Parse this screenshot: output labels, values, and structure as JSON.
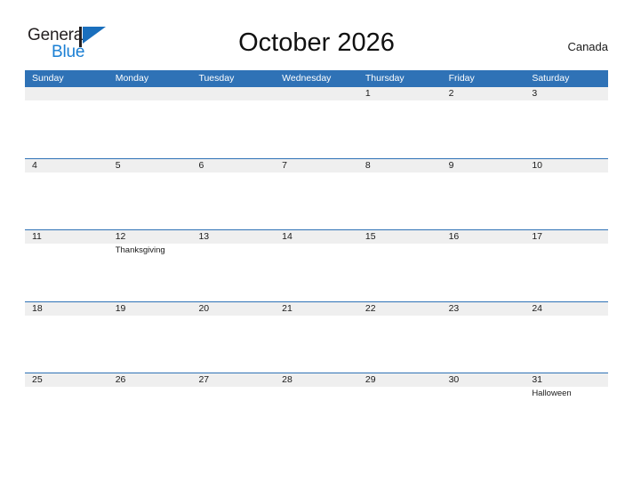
{
  "logo": {
    "word_top": "General",
    "word_bottom": "Blue",
    "flag_icon": "blue-flag-triangle-icon",
    "color_text": "#231f20",
    "color_blue": "#1a7fd4"
  },
  "header": {
    "title": "October 2026",
    "country": "Canada"
  },
  "theme": {
    "header_blue": "#2f72b6",
    "row_band_gray": "#efefef",
    "rule_blue": "#2f72b6",
    "page_background": "#ffffff"
  },
  "calendar": {
    "month": "October",
    "year": "2026",
    "weekdays": [
      "Sunday",
      "Monday",
      "Tuesday",
      "Wednesday",
      "Thursday",
      "Friday",
      "Saturday"
    ],
    "weeks": [
      [
        {
          "day": "",
          "event": ""
        },
        {
          "day": "",
          "event": ""
        },
        {
          "day": "",
          "event": ""
        },
        {
          "day": "",
          "event": ""
        },
        {
          "day": "1",
          "event": ""
        },
        {
          "day": "2",
          "event": ""
        },
        {
          "day": "3",
          "event": ""
        }
      ],
      [
        {
          "day": "4",
          "event": ""
        },
        {
          "day": "5",
          "event": ""
        },
        {
          "day": "6",
          "event": ""
        },
        {
          "day": "7",
          "event": ""
        },
        {
          "day": "8",
          "event": ""
        },
        {
          "day": "9",
          "event": ""
        },
        {
          "day": "10",
          "event": ""
        }
      ],
      [
        {
          "day": "11",
          "event": ""
        },
        {
          "day": "12",
          "event": "Thanksgiving"
        },
        {
          "day": "13",
          "event": ""
        },
        {
          "day": "14",
          "event": ""
        },
        {
          "day": "15",
          "event": ""
        },
        {
          "day": "16",
          "event": ""
        },
        {
          "day": "17",
          "event": ""
        }
      ],
      [
        {
          "day": "18",
          "event": ""
        },
        {
          "day": "19",
          "event": ""
        },
        {
          "day": "20",
          "event": ""
        },
        {
          "day": "21",
          "event": ""
        },
        {
          "day": "22",
          "event": ""
        },
        {
          "day": "23",
          "event": ""
        },
        {
          "day": "24",
          "event": ""
        }
      ],
      [
        {
          "day": "25",
          "event": ""
        },
        {
          "day": "26",
          "event": ""
        },
        {
          "day": "27",
          "event": ""
        },
        {
          "day": "28",
          "event": ""
        },
        {
          "day": "29",
          "event": ""
        },
        {
          "day": "30",
          "event": ""
        },
        {
          "day": "31",
          "event": "Halloween"
        }
      ]
    ]
  }
}
